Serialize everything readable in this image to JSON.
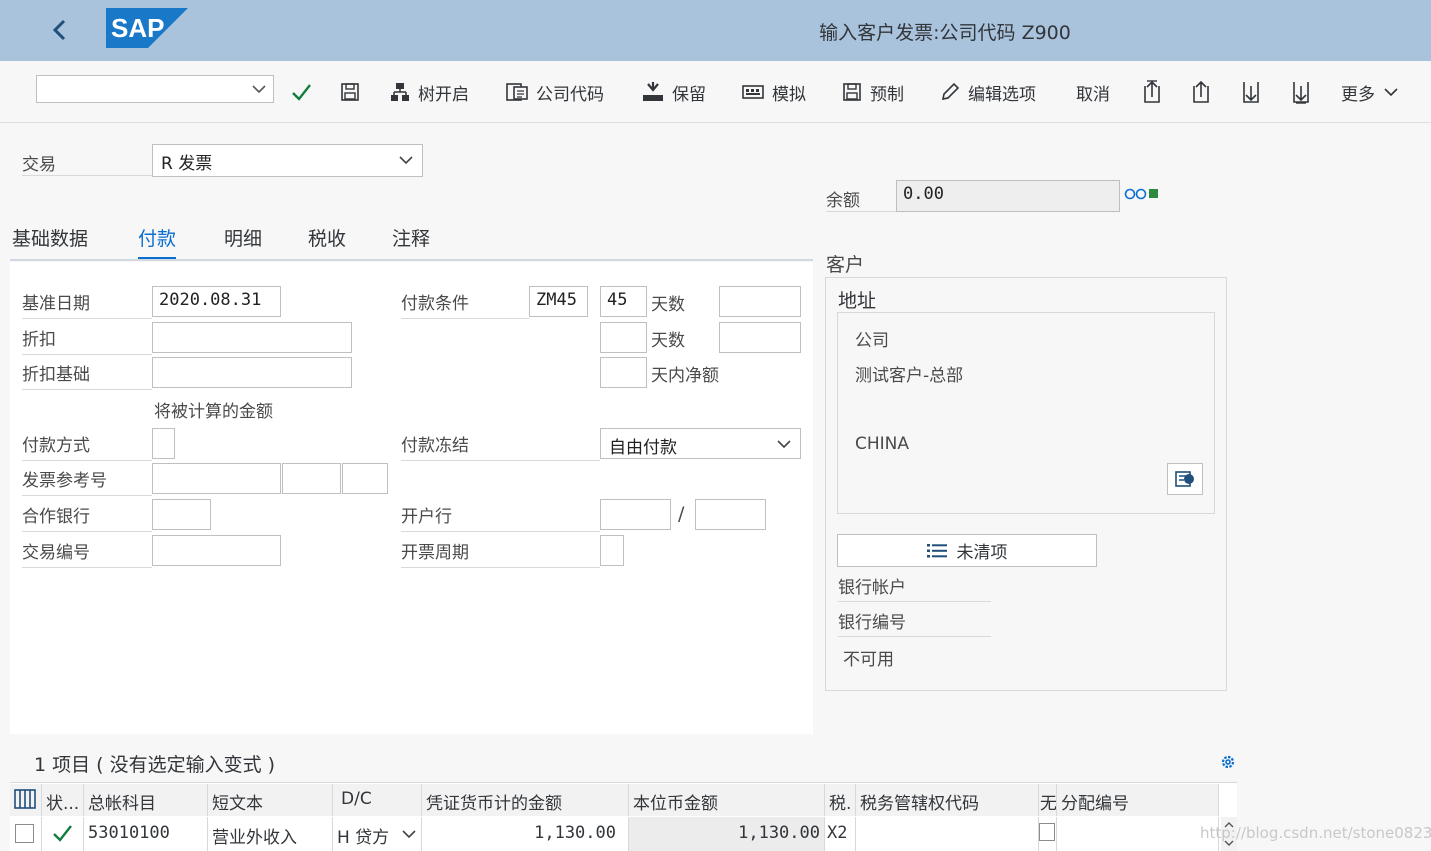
{
  "header": {
    "title": "输入客户发票:公司代码 Z900",
    "logo_text": "SAP"
  },
  "toolbar": {
    "command_value": "",
    "tree_on": "树开启",
    "company_code": "公司代码",
    "hold": "保留",
    "simulate": "模拟",
    "park": "预制",
    "edit_options": "编辑选项",
    "cancel": "取消",
    "more": "更多"
  },
  "transaction": {
    "label": "交易",
    "value": "R 发票"
  },
  "balance": {
    "label": "余额",
    "value": "0.00"
  },
  "tabs": [
    "基础数据",
    "付款",
    "明细",
    "税收",
    "注释"
  ],
  "payment": {
    "baseline_date_label": "基准日期",
    "baseline_date": "2020.08.31",
    "discount_label": "折扣",
    "discount_base_label": "折扣基础",
    "calc_note": "将被计算的金额",
    "pay_method_label": "付款方式",
    "invoice_ref_label": "发票参考号",
    "partner_bank_label": "合作银行",
    "transaction_no_label": "交易编号",
    "terms_label": "付款条件",
    "terms_value": "ZM45",
    "days1": "45",
    "days_label": "天数",
    "net_days_label": "天内净额",
    "block_label": "付款冻结",
    "block_value": "自由付款",
    "house_bank_label": "开户行",
    "slash": "/",
    "billing_period_label": "开票周期"
  },
  "customer": {
    "section_label": "客户",
    "address_label": "地址",
    "title": "公司",
    "name": "测试客户-总部",
    "country": "CHINA",
    "open_items_button": "未清项",
    "bank_account_label": "银行帐户",
    "bank_number_label": "银行编号",
    "not_available": "不可用"
  },
  "items": {
    "title": "1 项目 ( 没有选定输入变式 )",
    "columns": [
      "状...",
      "总帐科目",
      "短文本",
      "D/C",
      "凭证货币计的金额",
      "本位币金额",
      "税.",
      "税务管辖权代码",
      "无",
      "分配编号"
    ],
    "rows": [
      {
        "gl_account": "53010100",
        "short_text": "营业外收入",
        "dc": "H 贷方",
        "amount_doc": "1,130.00",
        "amount_local": "1,130.00",
        "tax": "X2",
        "jurisdiction": "",
        "assignment": ""
      }
    ]
  },
  "watermark": "http://blog.csdn.net/stone0823",
  "colors": {
    "header_bg": "#a9c3dd",
    "accent": "#0a6ed1",
    "check": "#107e3e",
    "status_green": "#2b8a3e"
  }
}
